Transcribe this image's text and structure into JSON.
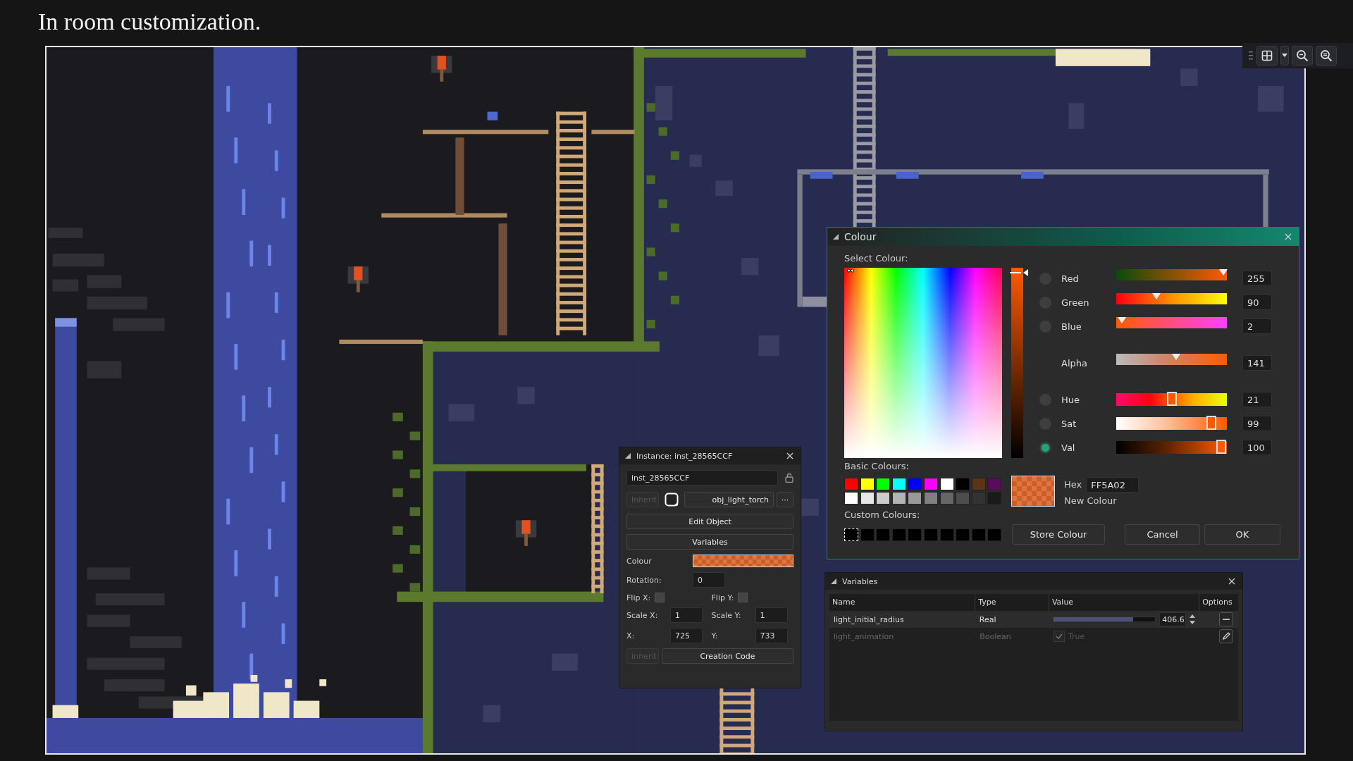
{
  "caption": "In room customization.",
  "instance_panel": {
    "title": "Instance: inst_28565CCF",
    "instance_name": "inst_28565CCF",
    "inherit_button": {
      "label": "Inherit",
      "disabled": true
    },
    "object_name": "obj_light_torch",
    "browse_button": "···",
    "edit_object_button": "Edit Object",
    "variables_button": "Variables",
    "colour_label": "Colour",
    "rotation": {
      "label": "Rotation:",
      "value": "0"
    },
    "flip_x": {
      "label": "Flip X:",
      "checked": false
    },
    "flip_y": {
      "label": "Flip Y:",
      "checked": false
    },
    "scale_x": {
      "label": "Scale X:",
      "value": "1"
    },
    "scale_y": {
      "label": "Scale Y:",
      "value": "1"
    },
    "x": {
      "label": "X:",
      "value": "725"
    },
    "y": {
      "label": "Y:",
      "value": "733"
    },
    "inherit_code_button": {
      "label": "Inherit",
      "disabled": true
    },
    "creation_code_button": "Creation Code"
  },
  "colour_dialog": {
    "title": "Colour",
    "select_label": "Select Colour:",
    "channels": [
      {
        "kind": "rgb",
        "label": "Red",
        "selected": false,
        "level": 0.97,
        "value": "255"
      },
      {
        "kind": "rgb",
        "label": "Green",
        "selected": false,
        "level": 0.36,
        "value": "90"
      },
      {
        "kind": "rgb",
        "label": "Blue",
        "selected": false,
        "level": 0.05,
        "value": "2"
      },
      {
        "kind": "alpha",
        "label": "Alpha",
        "level": 0.54,
        "value": "141"
      },
      {
        "kind": "hsv",
        "label": "Hue",
        "selected": false,
        "level": 0.5,
        "value": "21"
      },
      {
        "kind": "hsv",
        "label": "Sat",
        "selected": false,
        "level": 0.86,
        "value": "99"
      },
      {
        "kind": "hsv",
        "label": "Val",
        "selected": true,
        "level": 0.95,
        "value": "100"
      }
    ],
    "basic_label": "Basic Colours:",
    "basic_colours": [
      {
        "color": "#ff0000"
      },
      {
        "color": "#ffff00"
      },
      {
        "color": "#00ff00"
      },
      {
        "color": "#00ffff"
      },
      {
        "color": "#0000ff"
      },
      {
        "color": "#ff00ff"
      },
      {
        "color": "#ffffff"
      },
      {
        "color": "#000000"
      },
      {
        "color": "#5a3414"
      },
      {
        "color": "#5a0a5a"
      },
      {
        "color": "#ffffff"
      },
      {
        "color": "#e6e6e6"
      },
      {
        "color": "#cccccc"
      },
      {
        "color": "#b3b3b3"
      },
      {
        "color": "#999999"
      },
      {
        "color": "#808080"
      },
      {
        "color": "#666666"
      },
      {
        "color": "#4d4d4d"
      },
      {
        "color": "#333333"
      },
      {
        "color": "#1a1a1a"
      }
    ],
    "hex_label": "Hex",
    "hex_value": "FF5A02",
    "new_colour_label": "New Colour",
    "custom_label": "Custom Colours:",
    "custom_colours": [
      {
        "color": "#000000",
        "selected": true
      },
      {
        "color": "#000000",
        "selected": false
      },
      {
        "color": "#000000",
        "selected": false
      },
      {
        "color": "#000000",
        "selected": false
      },
      {
        "color": "#000000",
        "selected": false
      },
      {
        "color": "#000000",
        "selected": false
      },
      {
        "color": "#000000",
        "selected": false
      },
      {
        "color": "#000000",
        "selected": false
      },
      {
        "color": "#000000",
        "selected": false
      },
      {
        "color": "#000000",
        "selected": false
      }
    ],
    "buttons": [
      "Store Colour",
      "Cancel",
      "OK"
    ]
  },
  "variables_panel": {
    "title": "Variables",
    "columns": [
      "Name",
      "Type",
      "Value",
      "Options"
    ],
    "rows": [
      {
        "kind": "slider",
        "name": "light_initial_radius",
        "type": "Real",
        "value": "406.6",
        "level": 0.78,
        "selected": true,
        "disabled": false
      },
      {
        "kind": "checkbox",
        "name": "light_animation",
        "type": "Boolean",
        "value": "True",
        "checked": true,
        "selected": false,
        "disabled": true
      }
    ]
  }
}
